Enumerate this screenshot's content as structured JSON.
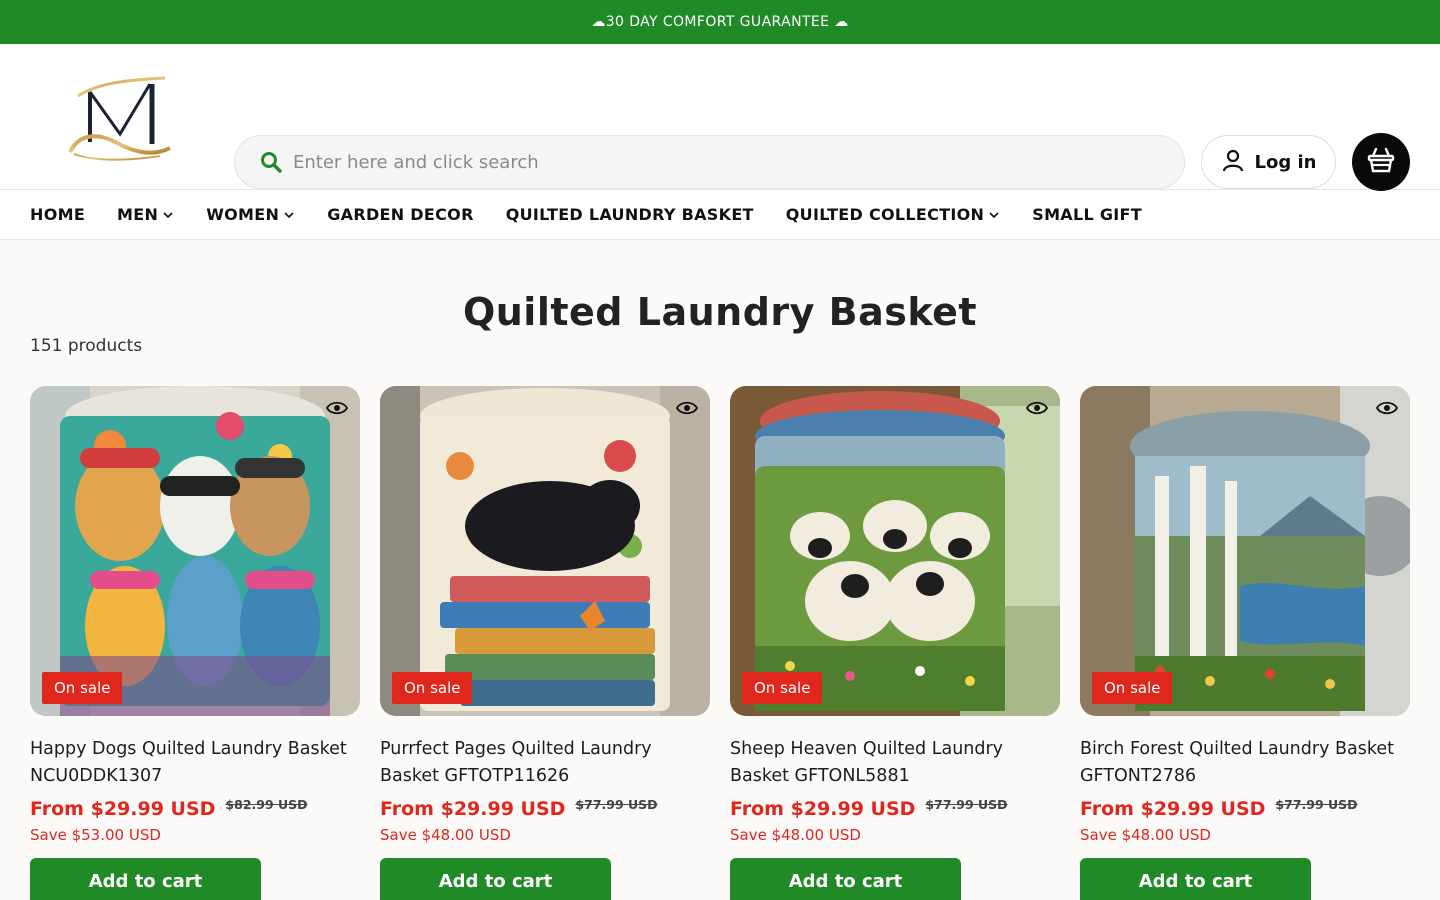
{
  "announcement": "☁30 DAY COMFORT GUARANTEE ☁",
  "search": {
    "placeholder": "Enter here and click search"
  },
  "account": {
    "login_label": "Log in"
  },
  "nav": [
    {
      "label": "HOME",
      "dropdown": false
    },
    {
      "label": "MEN",
      "dropdown": true
    },
    {
      "label": "WOMEN",
      "dropdown": true
    },
    {
      "label": "GARDEN DECOR",
      "dropdown": false
    },
    {
      "label": "QUILTED LAUNDRY BASKET",
      "dropdown": false
    },
    {
      "label": "QUILTED COLLECTION",
      "dropdown": true
    },
    {
      "label": "SMALL GIFT",
      "dropdown": false
    }
  ],
  "collection": {
    "title": "Quilted Laundry Basket",
    "count": "151 products"
  },
  "products": [
    {
      "name": "Happy Dogs Quilted Laundry Basket NCU0DDK1307",
      "badge": "On sale",
      "price": "From $29.99 USD",
      "compare": "$82.99 USD",
      "save": "Save $53.00 USD",
      "cta": "Add to cart"
    },
    {
      "name": "Purrfect Pages Quilted Laundry Basket GFTOTP11626",
      "badge": "On sale",
      "price": "From $29.99 USD",
      "compare": "$77.99 USD",
      "save": "Save $48.00 USD",
      "cta": "Add to cart"
    },
    {
      "name": "Sheep Heaven Quilted Laundry Basket GFTONL5881",
      "badge": "On sale",
      "price": "From $29.99 USD",
      "compare": "$77.99 USD",
      "save": "Save $48.00 USD",
      "cta": "Add to cart"
    },
    {
      "name": "Birch Forest Quilted Laundry Basket GFTONT2786",
      "badge": "On sale",
      "price": "From $29.99 USD",
      "compare": "$77.99 USD",
      "save": "Save $48.00 USD",
      "cta": "Add to cart"
    }
  ],
  "colors": {
    "brand_green": "#208a27",
    "sale_red": "#e0271d",
    "cart_bg": "#0a0a0a"
  }
}
